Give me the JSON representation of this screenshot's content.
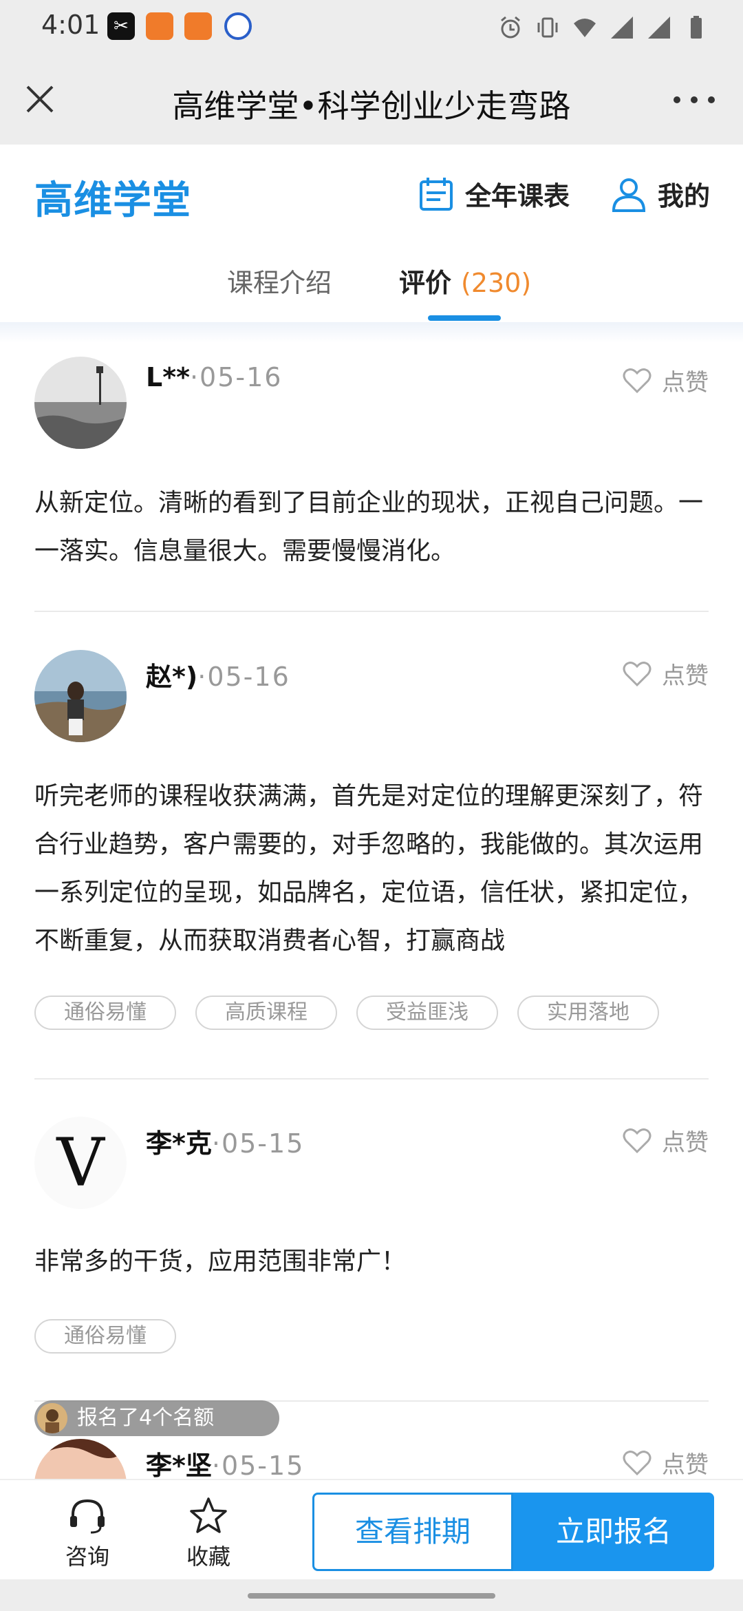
{
  "status_bar": {
    "time": "4:01",
    "capcut_glyph": "✂",
    "icons": [
      "capcut-icon",
      "reader-app-icon",
      "reader-app-icon",
      "ball-app-icon",
      "alarm-icon",
      "vibrate-icon",
      "wifi-icon",
      "signal-icon",
      "signal-icon",
      "battery-icon"
    ]
  },
  "title_bar": {
    "title": "高维学堂•科学创业少走弯路",
    "close_icon": "close-icon",
    "more_icon": "more-icon"
  },
  "header": {
    "logo": "高维学堂",
    "schedule_label": "全年课表",
    "mine_label": "我的",
    "accent_color": "#1a8fe3"
  },
  "tabs": {
    "intro": "课程介绍",
    "review": "评价",
    "review_count": "(230)",
    "active": "review"
  },
  "reviews": [
    {
      "name": "L**",
      "date": "·05-16",
      "like": "点赞",
      "text": "从新定位。清晰的看到了目前企业的现状，正视自己问题。一一落实。信息量很大。需要慢慢消化。",
      "tags": []
    },
    {
      "name": "赵*)",
      "date": "·05-16",
      "like": "点赞",
      "text": "听完老师的课程收获满满，首先是对定位的理解更深刻了，符合行业趋势，客户需要的，对手忽略的，我能做的。其次运用一系列定位的呈现，如品牌名，定位语，信任状，紧扣定位，不断重复，从而获取消费者心智，打赢商战",
      "tags": [
        "通俗易懂",
        "高质课程",
        "受益匪浅",
        "实用落地"
      ]
    },
    {
      "name": "李*克",
      "date": "·05-15",
      "like": "点赞",
      "avatar_letter": "V",
      "text": "非常多的干货，应用范围非常广！",
      "tags": [
        "通俗易懂"
      ]
    },
    {
      "name": "李*坚",
      "date": "·05-15",
      "like": "点赞",
      "text": "",
      "tags": []
    }
  ],
  "enroll_badge": "报名了4个名额",
  "bottom_bar": {
    "consult": "咨询",
    "favorite": "收藏",
    "schedule_button": "查看排期",
    "enroll_button": "立即报名"
  }
}
